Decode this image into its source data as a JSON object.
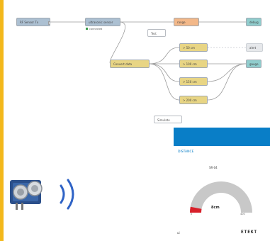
{
  "colors": {
    "accent_bar": "#f3b81b",
    "input_node": "#a6bbcf",
    "function_node": "#e7d27a",
    "change_node": "#f2b37f",
    "output_node": "#87c9c9",
    "ghost_node": "#e4e7ea",
    "dashboard_blue": "#097ec7",
    "gauge_track": "#c8c8c8",
    "gauge_fill": "#d8202a"
  },
  "flow": {
    "nodes": [
      {
        "id": "n1",
        "kind": "input",
        "label": "RF Sensor Tx"
      },
      {
        "id": "n2",
        "kind": "input",
        "label": "ultrasonic sensor"
      },
      {
        "id": "n3",
        "kind": "change",
        "label": "range"
      },
      {
        "id": "n4",
        "kind": "output",
        "label": "debug"
      },
      {
        "id": "n5",
        "kind": "function",
        "label": "Convert data"
      },
      {
        "id": "n6",
        "kind": "function",
        "label": "> 50 cm"
      },
      {
        "id": "n7",
        "kind": "function",
        "label": "> 100 cm"
      },
      {
        "id": "n8",
        "kind": "function",
        "label": "> 150 cm"
      },
      {
        "id": "n9",
        "kind": "function",
        "label": "> 200 cm"
      },
      {
        "id": "n10",
        "kind": "ghost",
        "label": "alert"
      },
      {
        "id": "n11",
        "kind": "output",
        "label": "gauge"
      }
    ],
    "status_text": "connected",
    "notes": [
      {
        "label": "Test"
      },
      {
        "label": "Simulate"
      }
    ]
  },
  "dashboard": {
    "tab_label": "DISTANCE",
    "gauge": {
      "title": "SR-04",
      "value": "8cm",
      "min": "0",
      "max": "400",
      "level_fraction": 0.02
    },
    "footer_left": "ui",
    "brand": "ETEKT"
  },
  "icons": {
    "sensor": "ultrasonic-sensor-icon",
    "waves": "signal-waves-icon"
  }
}
